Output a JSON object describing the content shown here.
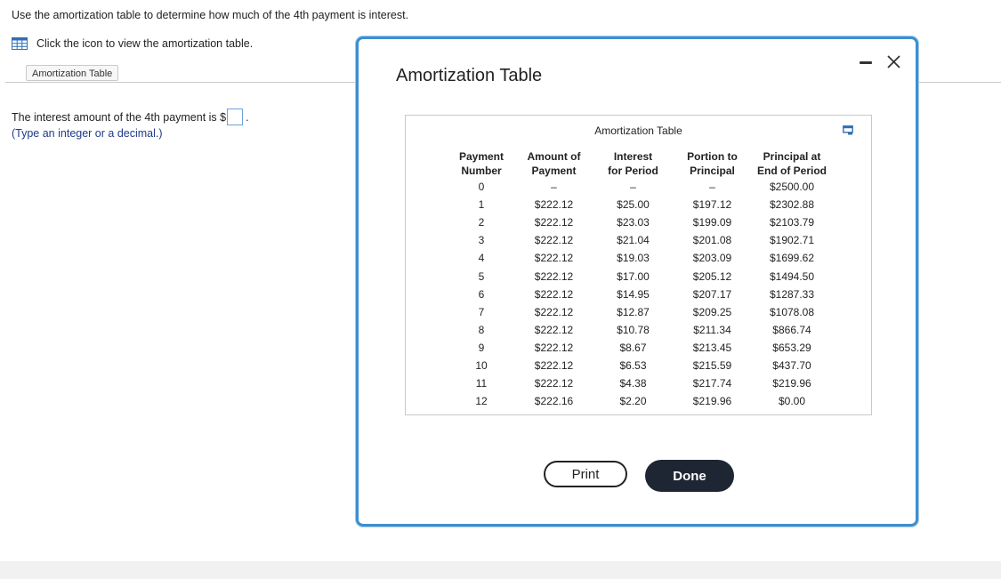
{
  "instructions": "Use the amortization table to determine how much of the 4th payment is interest.",
  "icon_prompt": "Click the icon to view the amortization table.",
  "amortization_button_label": "Amortization Table",
  "question": {
    "text": "The interest amount of the 4th payment is $",
    "answer_value": "",
    "suffix": ".",
    "hint": "(Type an integer or a decimal.)"
  },
  "modal": {
    "title": "Amortization Table",
    "panel_title": "Amortization Table",
    "print_label": "Print",
    "done_label": "Done"
  },
  "colors": {
    "accent_blue": "#3c8fcf",
    "hint_blue": "#1f3b8a",
    "done_bg": "#1f2633"
  },
  "table": {
    "headers": [
      [
        "Payment",
        "Number"
      ],
      [
        "Amount of",
        "Payment"
      ],
      [
        "Interest",
        "for Period"
      ],
      [
        "Portion to",
        "Principal"
      ],
      [
        "Principal at",
        "End of Period"
      ]
    ],
    "rows": [
      [
        "0",
        "–",
        "–",
        "–",
        "$2500.00"
      ],
      [
        "1",
        "$222.12",
        "$25.00",
        "$197.12",
        "$2302.88"
      ],
      [
        "2",
        "$222.12",
        "$23.03",
        "$199.09",
        "$2103.79"
      ],
      [
        "3",
        "$222.12",
        "$21.04",
        "$201.08",
        "$1902.71"
      ],
      [
        "4",
        "$222.12",
        "$19.03",
        "$203.09",
        "$1699.62"
      ],
      [
        "5",
        "$222.12",
        "$17.00",
        "$205.12",
        "$1494.50"
      ],
      [
        "6",
        "$222.12",
        "$14.95",
        "$207.17",
        "$1287.33"
      ],
      [
        "7",
        "$222.12",
        "$12.87",
        "$209.25",
        "$1078.08"
      ],
      [
        "8",
        "$222.12",
        "$10.78",
        "$211.34",
        "$866.74"
      ],
      [
        "9",
        "$222.12",
        "$8.67",
        "$213.45",
        "$653.29"
      ],
      [
        "10",
        "$222.12",
        "$6.53",
        "$215.59",
        "$437.70"
      ],
      [
        "11",
        "$222.12",
        "$4.38",
        "$217.74",
        "$219.96"
      ],
      [
        "12",
        "$222.16",
        "$2.20",
        "$219.96",
        "$0.00"
      ]
    ]
  }
}
